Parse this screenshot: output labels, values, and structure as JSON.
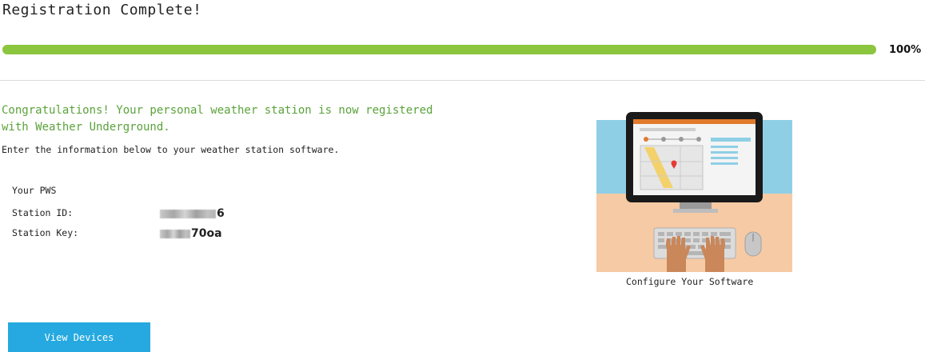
{
  "header": {
    "title": "Registration Complete!"
  },
  "progress": {
    "value": 100,
    "label": "100%",
    "color": "#8cc63f"
  },
  "message": {
    "congratulations": "Congratulations! Your personal weather station is now registered with Weather Underground.",
    "instructions": "Enter the information below to your weather station software."
  },
  "pws": {
    "heading": "Your PWS",
    "station_id_label": "Station ID:",
    "station_id_visible": "6",
    "station_key_label": "Station Key:",
    "station_key_visible": "70oa"
  },
  "illustration": {
    "caption": "Configure Your Software",
    "icon": "computer-setup-illustration"
  },
  "actions": {
    "view_devices_label": "View Devices",
    "button_color": "#25a9e0"
  },
  "colors": {
    "accent_green": "#5aa33a",
    "divider": "#dcdcdc"
  }
}
